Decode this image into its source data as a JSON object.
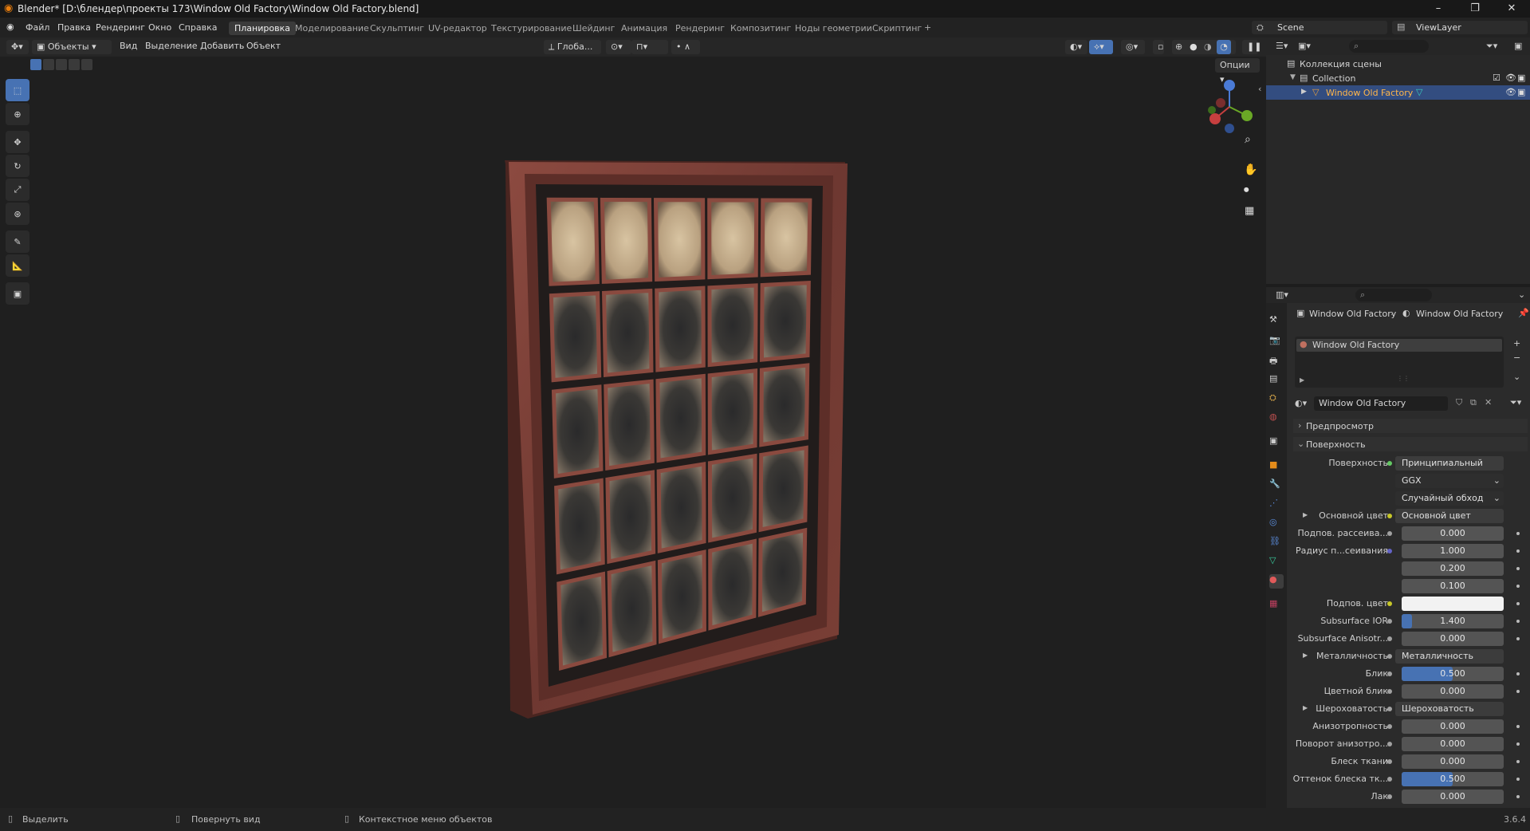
{
  "title": "Blender* [D:\\блендер\\проекты 173\\Window Old Factory\\Window Old Factory.blend]",
  "menus": [
    "Файл",
    "Правка",
    "Рендеринг",
    "Окно",
    "Справка"
  ],
  "workspaces": [
    "Планировка",
    "Моделирование",
    "Скульптинг",
    "UV-редактор",
    "Текстурирование",
    "Шейдинг",
    "Анимация",
    "Рендеринг",
    "Композитинг",
    "Ноды геометрии",
    "Скриптинг"
  ],
  "scene": "Scene",
  "view_layer": "ViewLayer",
  "header": {
    "mode": "Объекты",
    "view": "Вид",
    "select": "Выделение",
    "add": "Добавить",
    "object": "Объект",
    "orientation": "Глоба...",
    "options": "Опции"
  },
  "outliner": {
    "root": "Коллекция сцены",
    "collection": "Collection",
    "object": "Window Old Factory"
  },
  "props": {
    "breadcrumb_obj": "Window Old Factory",
    "breadcrumb_mat": "Window Old Factory",
    "slot": "Window Old Factory",
    "material": "Window Old Factory",
    "preview": "Предпросмотр",
    "surface_panel": "Поверхность",
    "rows": [
      {
        "label": "Поверхность",
        "value": "Принципиальный BSDF",
        "kind": "node",
        "socket": "#63c763"
      },
      {
        "label": "",
        "value": "GGX",
        "kind": "dropdown"
      },
      {
        "label": "",
        "value": "Случайный обход",
        "kind": "dropdown"
      },
      {
        "label": "Основной цвет",
        "value": "Основной цвет",
        "kind": "node",
        "socket": "#c7c729",
        "expand": true
      },
      {
        "label": "Подпов. рассеива...",
        "value": "0.000",
        "kind": "num",
        "socket": "#a1a1a1"
      },
      {
        "label": "Радиус п...сеивания",
        "value": "1.000",
        "kind": "num",
        "socket": "#6363c7"
      },
      {
        "label": "",
        "value": "0.200",
        "kind": "num"
      },
      {
        "label": "",
        "value": "0.100",
        "kind": "num"
      },
      {
        "label": "Подпов. цвет",
        "value": "",
        "kind": "color",
        "socket": "#c7c729"
      },
      {
        "label": "Subsurface IOR",
        "value": "1.400",
        "kind": "num",
        "socket": "#a1a1a1",
        "fill": 0.1
      },
      {
        "label": "Subsurface Anisotr...",
        "value": "0.000",
        "kind": "num",
        "socket": "#a1a1a1"
      },
      {
        "label": "Металличность",
        "value": "Металличность",
        "kind": "node",
        "socket": "#a1a1a1",
        "expand": true
      },
      {
        "label": "Блик",
        "value": "0.500",
        "kind": "num",
        "socket": "#a1a1a1",
        "fill": 0.5
      },
      {
        "label": "Цветной блик",
        "value": "0.000",
        "kind": "num",
        "socket": "#a1a1a1"
      },
      {
        "label": "Шероховатость",
        "value": "Шероховатость",
        "kind": "node",
        "socket": "#a1a1a1",
        "expand": true
      },
      {
        "label": "Анизотропность",
        "value": "0.000",
        "kind": "num",
        "socket": "#a1a1a1"
      },
      {
        "label": "Поворот анизотро...",
        "value": "0.000",
        "kind": "num",
        "socket": "#a1a1a1"
      },
      {
        "label": "Блеск ткани",
        "value": "0.000",
        "kind": "num",
        "socket": "#a1a1a1"
      },
      {
        "label": "Оттенок блеска тк...",
        "value": "0.500",
        "kind": "num",
        "socket": "#a1a1a1",
        "fill": 0.5
      },
      {
        "label": "Лак",
        "value": "0.000",
        "kind": "num",
        "socket": "#a1a1a1"
      }
    ]
  },
  "status": {
    "select": "Выделить",
    "rotate": "Повернуть вид",
    "context": "Контекстное меню объектов",
    "version": "3.6.4"
  },
  "colors": {
    "accent": "#4772b3",
    "window_frame": "#7a3b33"
  }
}
